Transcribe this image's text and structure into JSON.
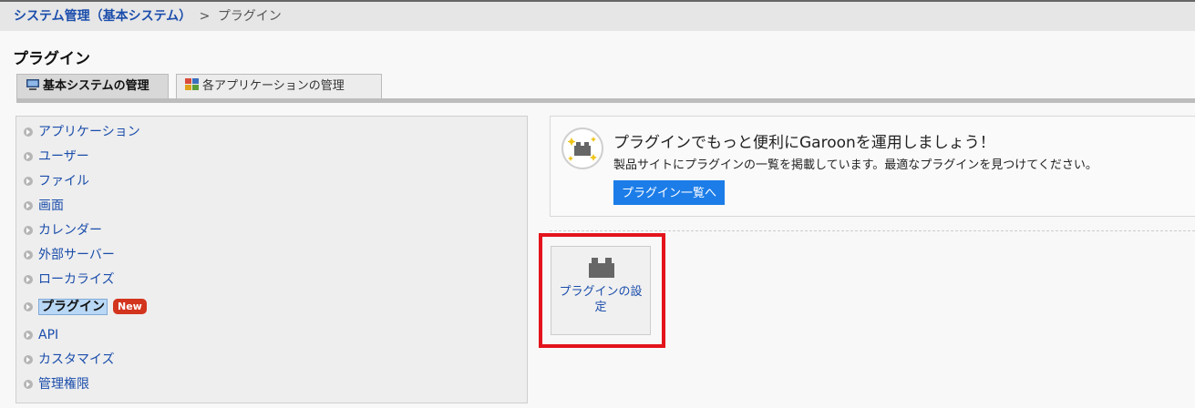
{
  "breadcrumb": {
    "parent": "システム管理（基本システム）",
    "separator": ">",
    "current": "プラグイン"
  },
  "page": {
    "title": "プラグイン"
  },
  "tabs": [
    {
      "label": "基本システムの管理",
      "icon": "computer-icon",
      "active": true
    },
    {
      "label": "各アプリケーションの管理",
      "icon": "apps-grid-icon",
      "active": false
    }
  ],
  "sidebar": {
    "items": [
      {
        "label": "アプリケーション"
      },
      {
        "label": "ユーザー"
      },
      {
        "label": "ファイル"
      },
      {
        "label": "画面"
      },
      {
        "label": "カレンダー"
      },
      {
        "label": "外部サーバー"
      },
      {
        "label": "ローカライズ"
      },
      {
        "label": "プラグイン",
        "active": true,
        "badge": "New"
      },
      {
        "label": "API"
      },
      {
        "label": "カスタマイズ"
      },
      {
        "label": "管理権限"
      }
    ]
  },
  "promo": {
    "icon": "plugin-sparkle-icon",
    "title": "プラグインでもっと便利にGaroonを運用しましょう！",
    "description": "製品サイトにプラグインの一覧を掲載しています。最適なプラグインを見つけてください。",
    "button": "プラグイン一覧へ"
  },
  "tiles": [
    {
      "label": "プラグインの設定",
      "icon": "plugin-block-icon"
    }
  ],
  "colors": {
    "link": "#1a4dab",
    "accent_button": "#1c7de8",
    "badge_new": "#d3341e",
    "highlight_frame": "#e3141c"
  }
}
